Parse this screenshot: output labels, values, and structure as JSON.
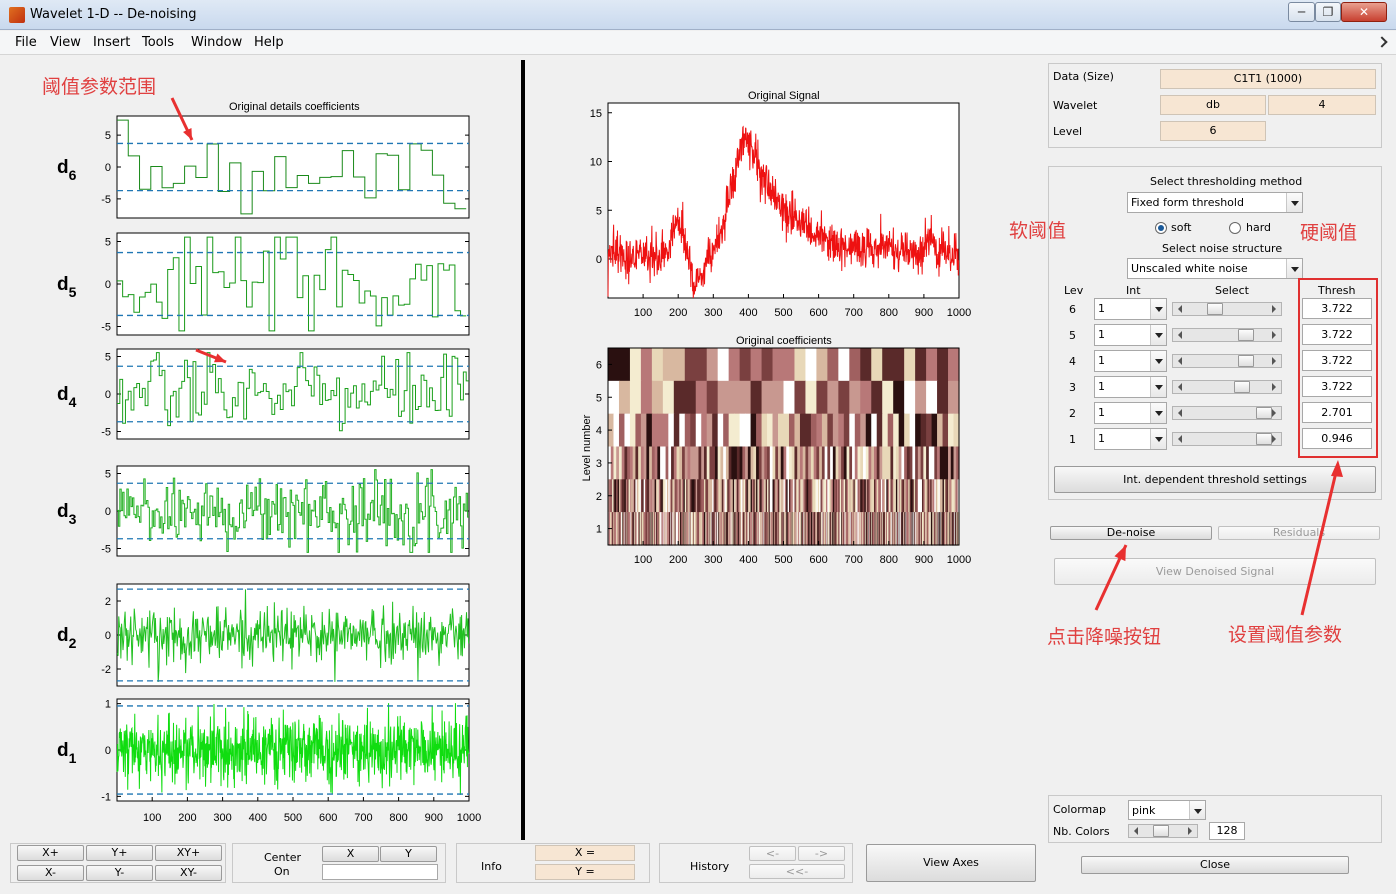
{
  "window": {
    "title": "Wavelet 1-D  --  De-noising",
    "minimize": "─",
    "restore": "❐",
    "close": "✕"
  },
  "menu": [
    "File",
    "View",
    "Insert",
    "Tools",
    "Window",
    "Help"
  ],
  "annotations": {
    "threshold_range": "阈值参数范围",
    "soft_threshold": "软阈值",
    "hard_threshold": "硬阈值",
    "click_denoise": "点击降噪按钮",
    "set_threshold": "设置阈值参数"
  },
  "details": {
    "title": "Original details coefficients",
    "levels": [
      {
        "label": "d",
        "sub": "6",
        "ticks": [
          "5",
          "0",
          "-5"
        ]
      },
      {
        "label": "d",
        "sub": "5",
        "ticks": [
          "5",
          "0",
          "-5"
        ]
      },
      {
        "label": "d",
        "sub": "4",
        "ticks": [
          "5",
          "0",
          "-5"
        ]
      },
      {
        "label": "d",
        "sub": "3",
        "ticks": [
          "5",
          "0",
          "-5"
        ]
      },
      {
        "label": "d",
        "sub": "2",
        "ticks": [
          "2",
          "0",
          "-2"
        ]
      },
      {
        "label": "d",
        "sub": "1",
        "ticks": [
          "1",
          "0",
          "-1"
        ]
      }
    ],
    "xticks": [
      "100",
      "200",
      "300",
      "400",
      "500",
      "600",
      "700",
      "800",
      "900",
      "1000"
    ]
  },
  "signal": {
    "title": "Original Signal",
    "yticks": [
      "15",
      "10",
      "5",
      "0"
    ],
    "xticks": [
      "100",
      "200",
      "300",
      "400",
      "500",
      "600",
      "700",
      "800",
      "900",
      "1000"
    ]
  },
  "coeffs": {
    "title": "Original coefficients",
    "ylabel": "Level number",
    "yticks": [
      "6",
      "5",
      "4",
      "3",
      "2",
      "1"
    ],
    "xticks": [
      "100",
      "200",
      "300",
      "400",
      "500",
      "600",
      "700",
      "800",
      "900",
      "1000"
    ]
  },
  "info": {
    "data_label": "Data  (Size)",
    "data_value": "C1T1  (1000)",
    "wavelet_label": "Wavelet",
    "wavelet_family": "db",
    "wavelet_order": "4",
    "level_label": "Level",
    "level_value": "6"
  },
  "denoise": {
    "method_label": "Select thresholding method",
    "method_value": "Fixed form threshold",
    "soft_label": "soft",
    "hard_label": "hard",
    "noise_label": "Select noise structure",
    "noise_value": "Unscaled white noise",
    "col_lev": "Lev",
    "col_int": "Int",
    "col_select": "Select",
    "col_thresh": "Thresh",
    "rows": [
      {
        "lev": "6",
        "int": "1",
        "thresh": "3.722",
        "pos": 0.33
      },
      {
        "lev": "5",
        "int": "1",
        "thresh": "3.722",
        "pos": 0.74
      },
      {
        "lev": "4",
        "int": "1",
        "thresh": "3.722",
        "pos": 0.74
      },
      {
        "lev": "3",
        "int": "1",
        "thresh": "3.722",
        "pos": 0.69
      },
      {
        "lev": "2",
        "int": "1",
        "thresh": "2.701",
        "pos": 0.98
      },
      {
        "lev": "1",
        "int": "1",
        "thresh": "0.946",
        "pos": 0.98
      }
    ],
    "int_dep_btn": "Int. dependent threshold settings",
    "denoise_btn": "De-noise",
    "residuals_btn": "Residuals",
    "view_denoised_btn": "View Denoised Signal"
  },
  "colormap": {
    "label": "Colormap",
    "value": "pink",
    "nb_label": "Nb. Colors",
    "nb_value": "128",
    "nb_pos": 0.4
  },
  "close_btn": "Close",
  "axes_ctrl": {
    "xplus": "X+",
    "yplus": "Y+",
    "xyplus": "XY+",
    "xminus": "X-",
    "yminus": "Y-",
    "xyminus": "XY-",
    "center": "Center",
    "on": "On",
    "x": "X",
    "y": "Y",
    "info": "Info",
    "xeq": "X =",
    "yeq": "Y =",
    "history": "History",
    "back": "<-",
    "fwd": "->",
    "begin": "<<-",
    "view_axes": "View Axes"
  }
}
